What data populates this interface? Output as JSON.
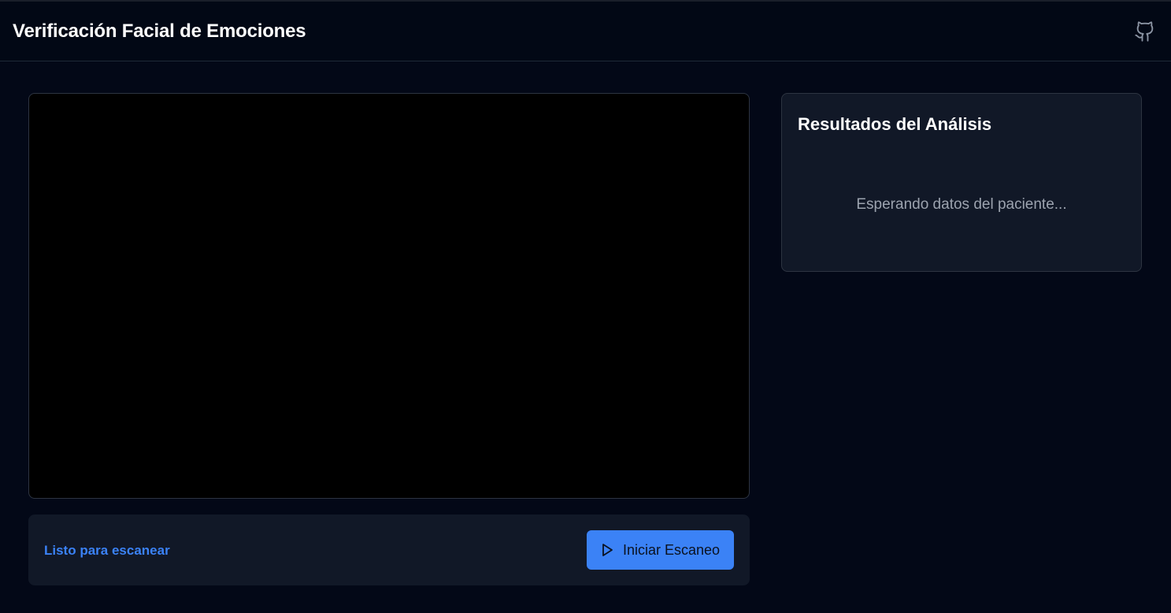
{
  "header": {
    "title": "Verificación Facial de Emociones",
    "github_icon": "github-icon"
  },
  "camera": {
    "status_text": "Listo para escanear",
    "start_button_label": "Iniciar Escaneo",
    "start_button_icon": "play-icon"
  },
  "results": {
    "title": "Resultados del Análisis",
    "placeholder_text": "Esperando datos del paciente..."
  },
  "colors": {
    "background": "#030817",
    "panel": "#111827",
    "accent": "#3b82f6",
    "muted_text": "#9ca3af"
  }
}
